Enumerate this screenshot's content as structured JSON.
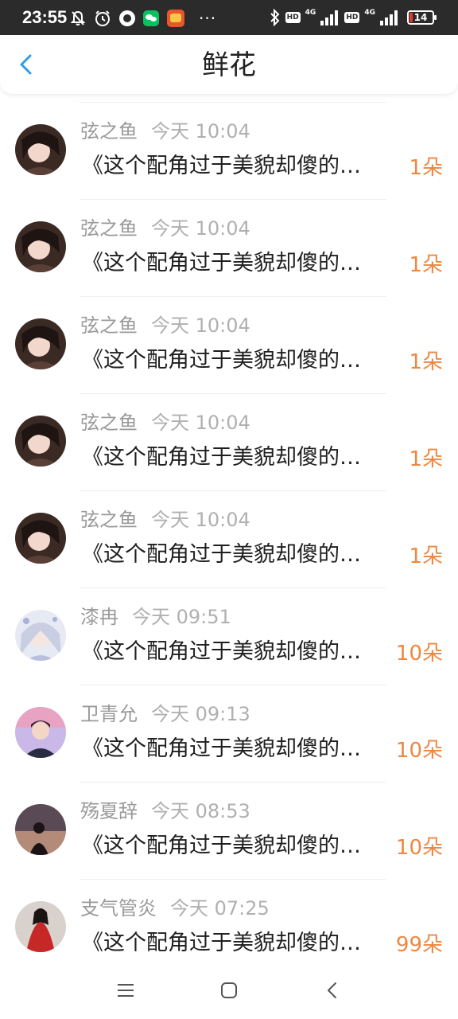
{
  "status_bar": {
    "time": "23:55",
    "more": "···",
    "hd_1": "HD",
    "net_1": "4G",
    "hd_2": "HD",
    "net_2": "4G",
    "battery": "14",
    "battery_color": "#e53935",
    "battery_level": 0.14
  },
  "header": {
    "title": "鲜花",
    "back_icon": "chevron-left-icon",
    "accent": "#2a9fe8"
  },
  "colors": {
    "name": "#9a9a9a",
    "time": "#b0b0b0",
    "message": "#1f1f1f",
    "flowers": "#ee8740"
  },
  "items": [
    {
      "name": "弦之鱼",
      "time": "今天 10:04",
      "message": "《这个配角过于美貌却傻的…",
      "flowers": "1朵",
      "avatar": "girl-dark-hair-avatar"
    },
    {
      "name": "弦之鱼",
      "time": "今天 10:04",
      "message": "《这个配角过于美貌却傻的…",
      "flowers": "1朵",
      "avatar": "girl-dark-hair-avatar"
    },
    {
      "name": "弦之鱼",
      "time": "今天 10:04",
      "message": "《这个配角过于美貌却傻的…",
      "flowers": "1朵",
      "avatar": "girl-dark-hair-avatar"
    },
    {
      "name": "弦之鱼",
      "time": "今天 10:04",
      "message": "《这个配角过于美貌却傻的…",
      "flowers": "1朵",
      "avatar": "girl-dark-hair-avatar"
    },
    {
      "name": "弦之鱼",
      "time": "今天 10:04",
      "message": "《这个配角过于美貌却傻的…",
      "flowers": "1朵",
      "avatar": "girl-dark-hair-avatar"
    },
    {
      "name": "漆冉",
      "time": "今天 09:51",
      "message": "《这个配角过于美貌却傻的…",
      "flowers": "10朵",
      "avatar": "anime-silver-hair-avatar"
    },
    {
      "name": "卫青允",
      "time": "今天 09:13",
      "message": "《这个配角过于美貌却傻的…",
      "flowers": "10朵",
      "avatar": "young-man-avatar"
    },
    {
      "name": "殇夏辞",
      "time": "今天 08:53",
      "message": "《这个配角过于美貌却傻的…",
      "flowers": "10朵",
      "avatar": "silhouette-sunset-avatar"
    },
    {
      "name": "支气管炎",
      "time": "今天 07:25",
      "message": "《这个配角过于美貌却傻的…",
      "flowers": "99朵",
      "avatar": "red-robe-figure-avatar"
    }
  ],
  "nav": {
    "menu_icon": "menu-icon",
    "home_icon": "home-icon",
    "back_icon": "back-icon"
  }
}
